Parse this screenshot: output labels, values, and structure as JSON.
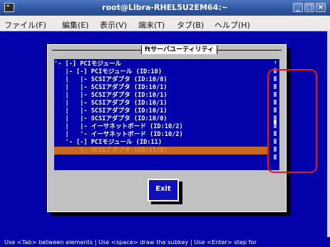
{
  "window": {
    "title": "root@Libra-RHEL5U2EM64:~",
    "buttons": {
      "minimize": "_",
      "maximize": "□",
      "close": "×"
    }
  },
  "menu": [
    "ファイル(F)",
    "編集(E)",
    "表示(V)",
    "端末(T)",
    "タブ(B)",
    "ヘルプ(H)"
  ],
  "dialog": {
    "title": "ftサーバユーティリティ",
    "tree": [
      "'- [-] PCIモジュール",
      "   |- [-] PCIモジュール (ID:10)",
      "   |   |- SCSIアダプタ (ID:10/8)",
      "   |   |- SCSIアダプタ (ID:10/1)",
      "   |   |- SCSIアダプタ (ID:10/1)",
      "   |   |- SCSIアダプタ (ID:10/1)",
      "   |   |- SCSIアダプタ (ID:10/1)",
      "   |   |- SCSIアダプタ (ID:10/0)",
      "   |   |- イーサネットボード (ID:10/2)",
      "   |   '- イーサネットボード (ID:10/2)",
      "   '- [-] PCIモジュール (ID:11)",
      "       |- SCSIアダプタ (ID:11/8)"
    ],
    "selected_index": 11,
    "scroll_arrow": "↑",
    "scroll_position": 0.55,
    "exit_label": "Exit"
  },
  "status_bar": "Use <Tab> between elements  | Use <space> draw the subkey | Use <Enter> step for",
  "colors": {
    "terminal_bg": "#0000aa",
    "dialog_bg": "#c0c0c0",
    "selected_row": "#c56a1e",
    "highlight": "#e8141e"
  }
}
